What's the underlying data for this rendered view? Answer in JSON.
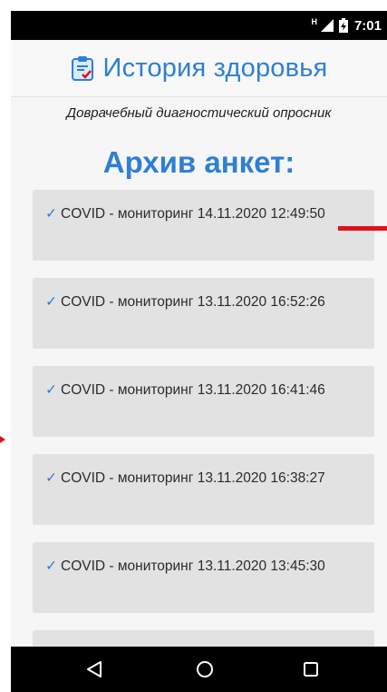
{
  "status_bar": {
    "network": "H",
    "time": "7:01"
  },
  "header": {
    "app_icon": "clipboard-check-icon",
    "title": "История здоровья"
  },
  "subtitle": "Доврачебный диагностический опросник",
  "section_title": "Архив анкет:",
  "archive_items": [
    {
      "check": "✓",
      "label": "COVID - мониторинг 14.11.2020 12:49:50"
    },
    {
      "check": "✓",
      "label": "COVID - мониторинг 13.11.2020 16:52:26"
    },
    {
      "check": "✓",
      "label": "COVID - мониторинг 13.11.2020 16:41:46"
    },
    {
      "check": "✓",
      "label": "COVID - мониторинг 13.11.2020 16:38:27"
    },
    {
      "check": "✓",
      "label": "COVID - мониторинг 13.11.2020 13:45:30"
    },
    {
      "check": "✓",
      "label": ""
    }
  ],
  "navigation": {
    "back_icon": "back-triangle-icon",
    "home_icon": "home-circle-icon",
    "recents_icon": "recents-square-icon"
  },
  "colors": {
    "accent": "#2f7fd3",
    "card_bg": "#e2e2e2",
    "annotation_red": "#e0121c"
  }
}
